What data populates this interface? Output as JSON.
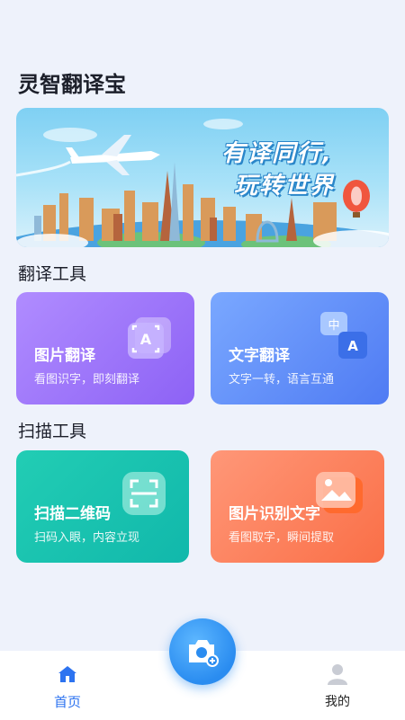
{
  "app": {
    "title": "灵智翻译宝"
  },
  "banner": {
    "slogan_line1": "有译同行,",
    "slogan_line2": "玩转世界"
  },
  "sections": {
    "translate_tools": "翻译工具",
    "scan_tools": "扫描工具"
  },
  "cards": {
    "photo_translate": {
      "title": "图片翻译",
      "subtitle": "看图识字，即刻翻译",
      "icon": "image-translate-icon"
    },
    "text_translate": {
      "title": "文字翻译",
      "subtitle": "文字一转，语言互通",
      "icon": "language-translate-icon"
    },
    "scan_qr": {
      "title": "扫描二维码",
      "subtitle": "扫码入眼，内容立现",
      "icon": "qr-scan-icon"
    },
    "image_ocr": {
      "title": "图片识别文字",
      "subtitle": "看图取字，瞬间提取",
      "icon": "image-icon"
    }
  },
  "tabbar": {
    "home": {
      "label": "首页",
      "icon": "home-icon"
    },
    "camera": {
      "icon": "camera-icon"
    },
    "mine": {
      "label": "我的",
      "icon": "user-icon"
    }
  },
  "colors": {
    "accent": "#2d73f0",
    "photo_card": "#9a72f8",
    "text_card": "#5f8df6",
    "qr_card": "#17c2b0",
    "ocr_card": "#fb7f5a"
  }
}
